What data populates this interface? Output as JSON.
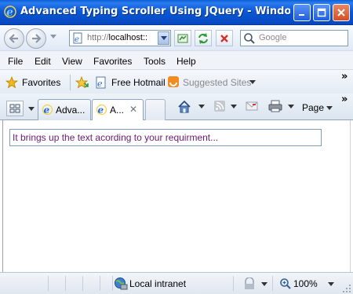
{
  "window": {
    "title": "Advanced Typing Scroller Using JQuery - Windows I...",
    "colors": {
      "titlebar": "#0b59d6",
      "close_button": "#d44f25"
    }
  },
  "address_bar": {
    "url_protocol": "http://",
    "url_host": "localhost::",
    "search_placeholder": "Google"
  },
  "menu": {
    "items": [
      "File",
      "Edit",
      "View",
      "Favorites",
      "Tools",
      "Help"
    ]
  },
  "favorites_bar": {
    "favorites_label": "Favorites",
    "links": [
      "Free Hotmail",
      "Suggested Sites"
    ],
    "overflow": "»"
  },
  "tabs": {
    "items": [
      {
        "label": "Adva...",
        "active": false
      },
      {
        "label": "A...",
        "active": true
      }
    ],
    "close_glyph": "✕",
    "command_bar": {
      "page_label": "Page",
      "overflow": "»"
    }
  },
  "content": {
    "scroller_text": "It brings up the text acording to your requirment...",
    "scroller_text_color": "#6a1a75"
  },
  "status_bar": {
    "zone": "Local intranet",
    "zoom": "100%"
  }
}
